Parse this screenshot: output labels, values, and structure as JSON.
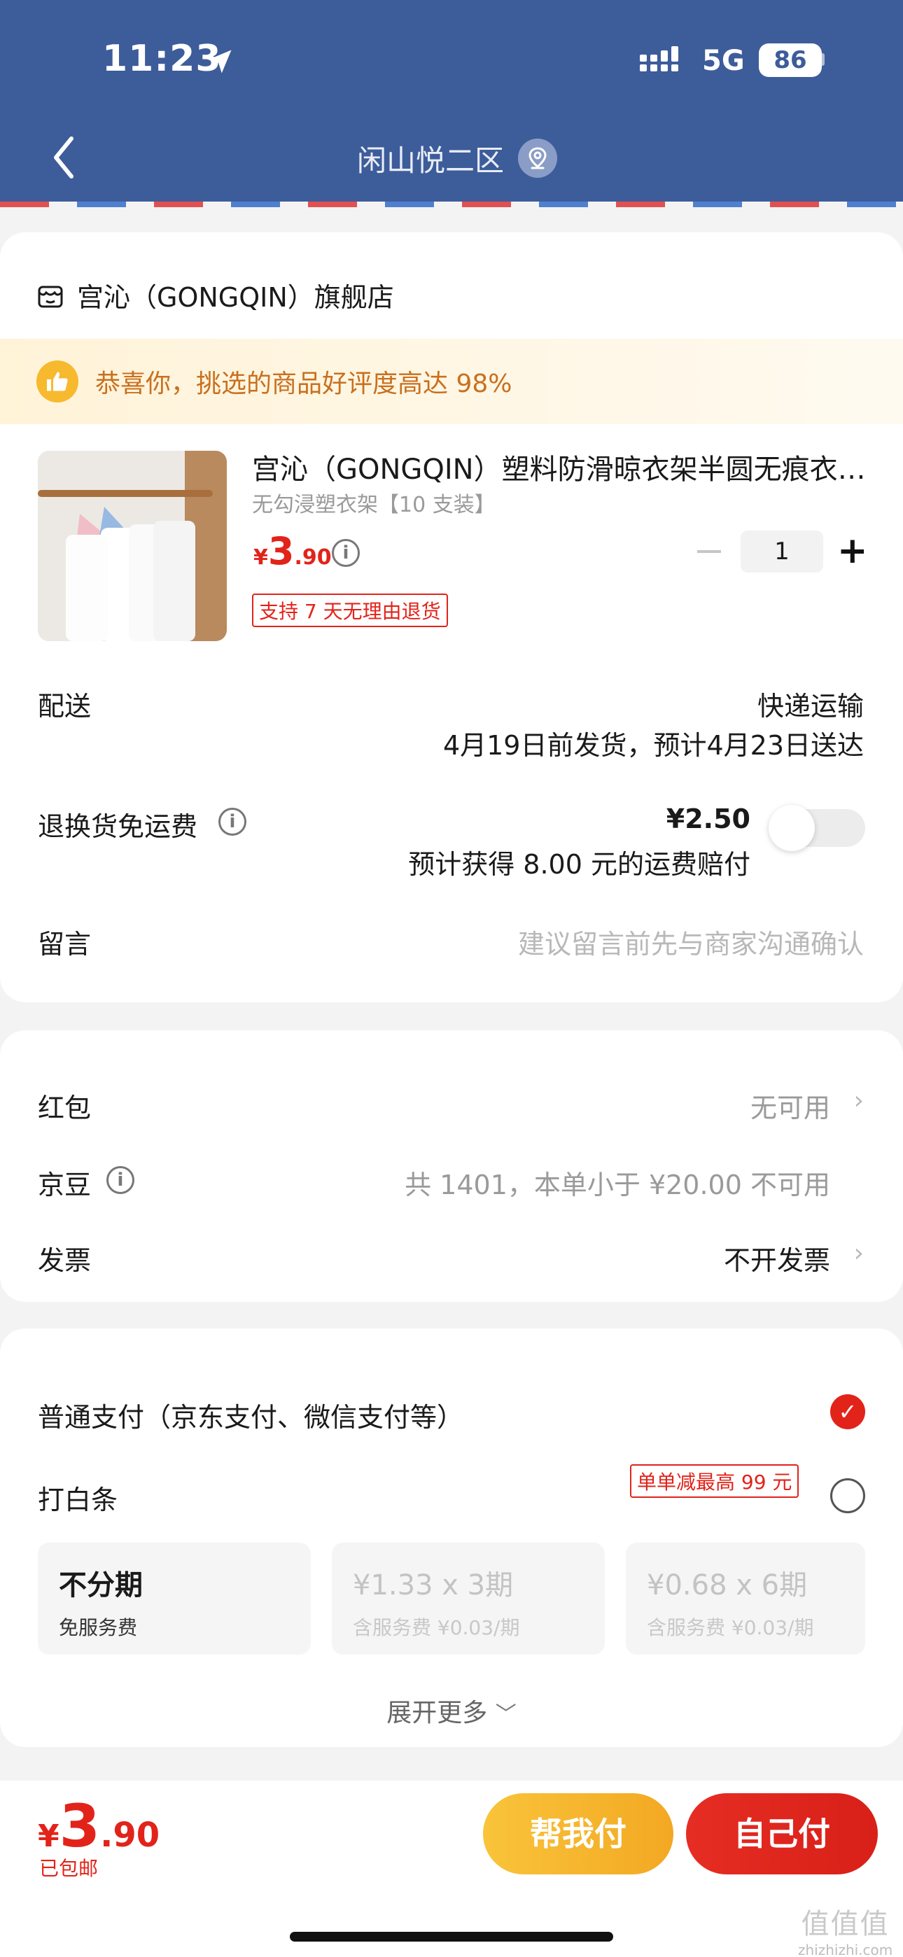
{
  "status_bar": {
    "time": "11:23",
    "network": "5G",
    "battery": "86"
  },
  "header": {
    "title": "闲山悦二区",
    "bg_color": "#3d5c9a"
  },
  "store": {
    "name": "宫沁（GONGQIN）旗舰店"
  },
  "praise": {
    "text": "恭喜你，挑选的商品好评度高达 98%"
  },
  "product": {
    "title": "宫沁（GONGQIN）塑料防滑晾衣架半圆无痕衣…",
    "spec": "无勾浸塑衣架【10 支装】",
    "price_symbol": "¥",
    "price_int": "3",
    "price_dec": ".90",
    "quantity": "1",
    "return_tag": "支持 7 天无理由退货"
  },
  "delivery": {
    "label": "配送",
    "method": "快递运输",
    "schedule": "4月19日前发货，预计4月23日送达"
  },
  "return_insurance": {
    "label": "退换货免运费",
    "price": "¥2.50",
    "compensation": "预计获得 8.00 元的运费赔付",
    "enabled": false
  },
  "message": {
    "label": "留言",
    "placeholder": "建议留言前先与商家沟通确认"
  },
  "benefits": {
    "redpacket_label": "红包",
    "redpacket_value": "无可用",
    "jd_bean_label": "京豆",
    "jd_bean_value": "共 1401，本单小于 ¥20.00 不可用",
    "invoice_label": "发票",
    "invoice_value": "不开发票"
  },
  "payment": {
    "normal_label": "普通支付（京东支付、微信支付等）",
    "normal_selected": true,
    "baitiao_label": "打白条",
    "baitiao_promo": "单单减最高 99 元",
    "baitiao_selected": false,
    "plans": [
      {
        "title": "不分期",
        "sub": "免服务费",
        "enabled": true
      },
      {
        "title": "¥1.33 x 3期",
        "sub": "含服务费 ¥0.03/期",
        "enabled": false
      },
      {
        "title": "¥0.68 x 6期",
        "sub": "含服务费 ¥0.03/期",
        "enabled": false
      }
    ],
    "expand_label": "展开更多"
  },
  "footer": {
    "total_symbol": "¥",
    "total_int": "3",
    "total_dec": ".90",
    "shipping_note": "已包邮",
    "help_pay_label": "帮我付",
    "self_pay_label": "自己付",
    "accent_color": "#e2231a"
  },
  "watermark": {
    "text": "值值值",
    "url": "zhizhizhi.com"
  }
}
